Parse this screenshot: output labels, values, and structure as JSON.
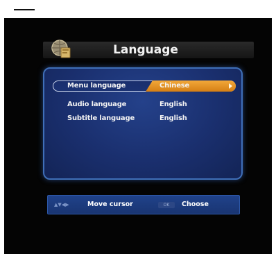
{
  "header": {
    "title": "Language",
    "icon": "globe-book-icon"
  },
  "settings": {
    "rows": [
      {
        "label": "Menu language",
        "value": "Chinese",
        "selected": true
      },
      {
        "label": "Audio language",
        "value": "English",
        "selected": false
      },
      {
        "label": "Subtitle language",
        "value": "English",
        "selected": false
      }
    ]
  },
  "footer": {
    "nav_keys": "▲▼◀▶",
    "move_label": "Move cursor",
    "ok_key": "OK",
    "choose_label": "Choose"
  },
  "colors": {
    "panel": "#1a2f6e",
    "panel_border": "#3f6fb8",
    "highlight": "#e8952a",
    "screen": "#040404"
  }
}
